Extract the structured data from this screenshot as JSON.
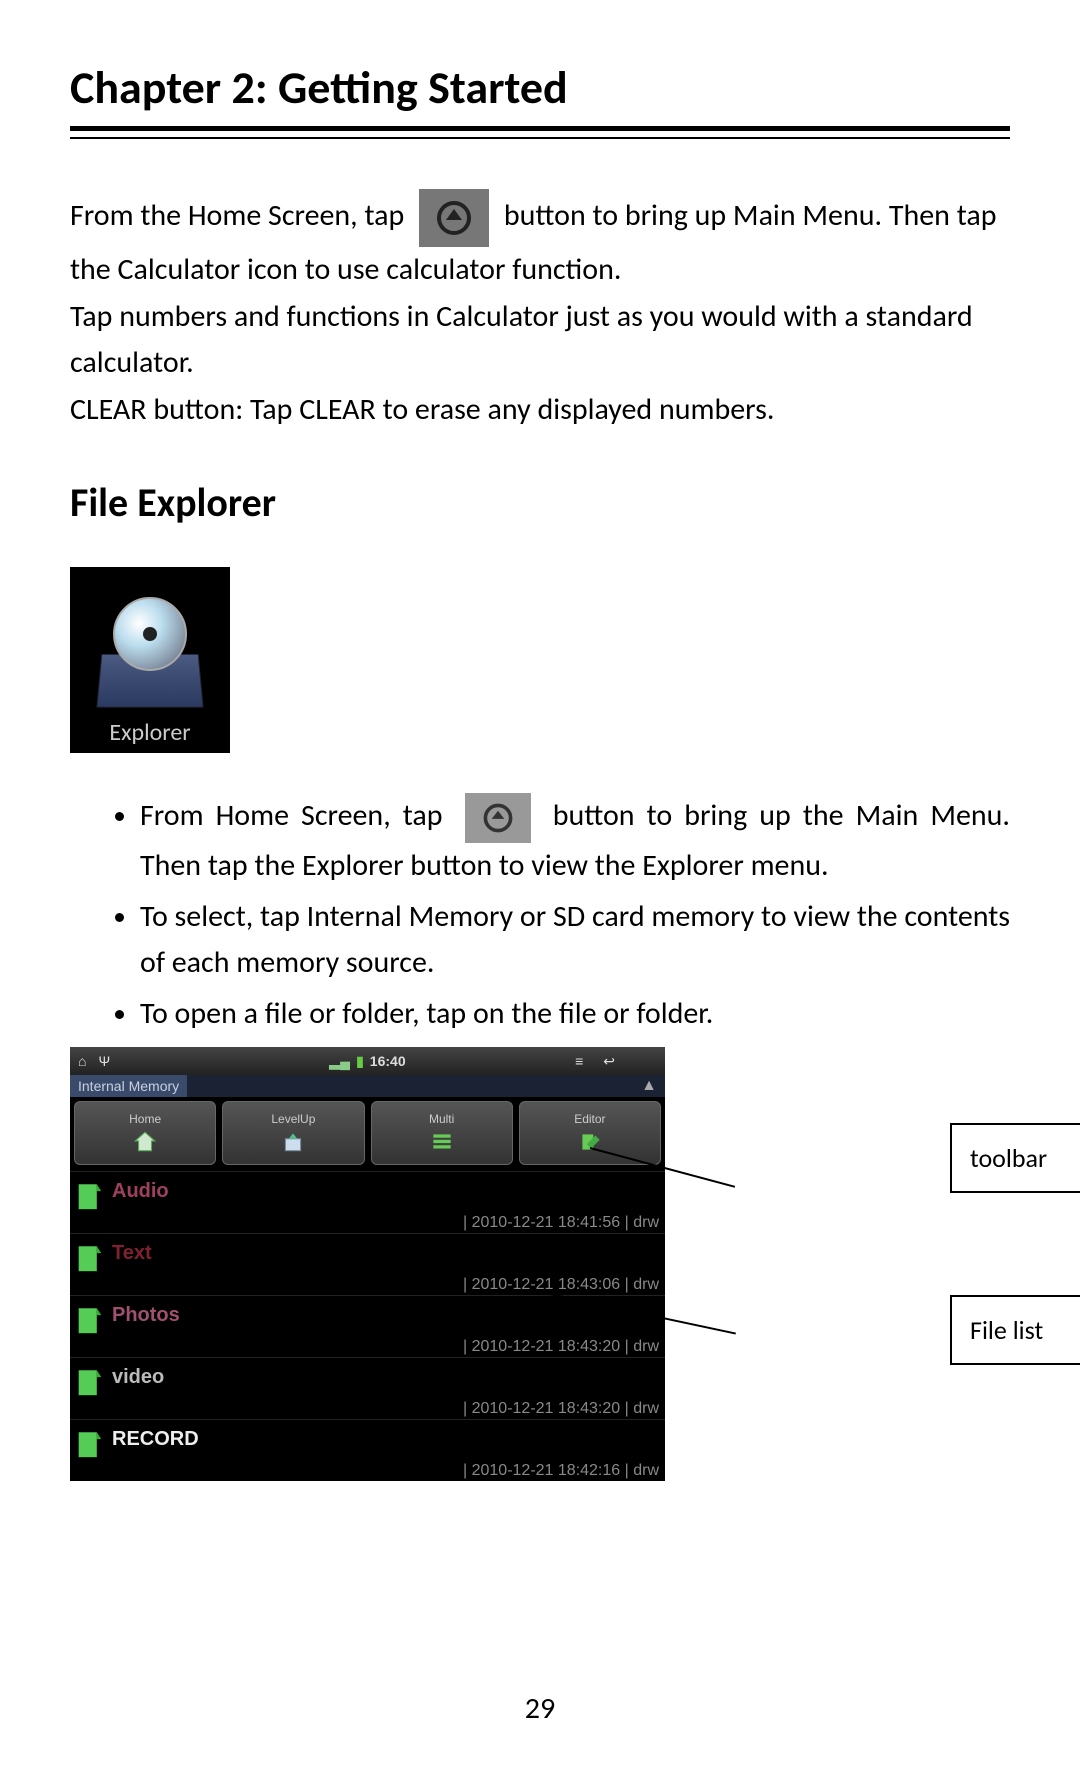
{
  "chapter_title": "Chapter 2: Getting Started",
  "intro": {
    "line1_a": "From the Home Screen, tap",
    "line1_b": "button to bring up Main Menu.",
    "line2": "Then tap the Calculator icon to use calculator function.",
    "line3": "Tap numbers and functions in Calculator just as you would with a standard calculator.",
    "line4": "CLEAR button: Tap CLEAR to erase any displayed numbers."
  },
  "section_title": "File Explorer",
  "explorer_icon_label": "Explorer",
  "bullets": {
    "b1_a": "From Home Screen, tap",
    "b1_b": "button to bring up the Main Menu.  Then tap the Explorer button to view the Explorer menu.",
    "b2": "To select, tap Internal Memory or SD card memory to view the contents of each memory source.",
    "b3": "To open a file or folder, tap on the file or folder."
  },
  "screenshot": {
    "status_time": "16:40",
    "breadcrumb": "Internal Memory",
    "toolbar": [
      {
        "label": "Home"
      },
      {
        "label": "LevelUp"
      },
      {
        "label": "Multi"
      },
      {
        "label": "Editor"
      }
    ],
    "files": [
      {
        "name": "Audio",
        "meta": "| 2010-12-21 18:41:56 | drw",
        "cls": "c-audio"
      },
      {
        "name": "Text",
        "meta": "| 2010-12-21 18:43:06 | drw",
        "cls": "c-text"
      },
      {
        "name": "Photos",
        "meta": "| 2010-12-21 18:43:20 | drw",
        "cls": "c-photos"
      },
      {
        "name": "video",
        "meta": "| 2010-12-21 18:43:20 | drw",
        "cls": "c-video"
      },
      {
        "name": "RECORD",
        "meta": "| 2010-12-21 18:42:16 | drw",
        "cls": "c-record"
      }
    ]
  },
  "callouts": {
    "toolbar": "toolbar",
    "filelist": "File list"
  },
  "page_number": "29"
}
